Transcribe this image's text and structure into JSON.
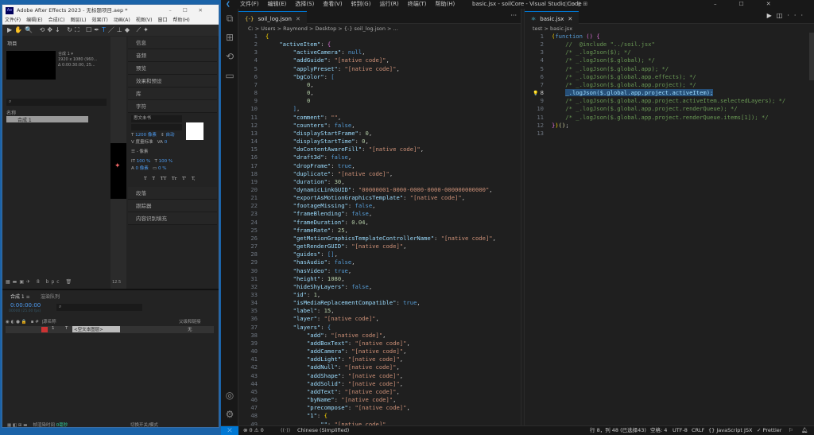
{
  "vscode": {
    "menu": [
      "文件(F)",
      "编辑(E)",
      "选择(S)",
      "查看(V)",
      "转到(G)",
      "运行(R)",
      "终端(T)",
      "帮助(H)"
    ],
    "window_title": "basic.jsx - soilCore - Visual Studio Code",
    "left": {
      "tab": "soil_log.json",
      "breadcrumb": "C: > Users > Raymond > Desktop > {-} soil_log.json > ...",
      "lines": [
        [
          [
            "y",
            "{"
          ]
        ],
        [
          [
            "p",
            "    "
          ],
          [
            "k",
            "\"activeItem\""
          ],
          [
            "p",
            ": "
          ],
          [
            "m",
            "{"
          ]
        ],
        [
          [
            "p",
            "        "
          ],
          [
            "k",
            "\"activeCamera\""
          ],
          [
            "p",
            ": "
          ],
          [
            "b",
            "null"
          ],
          [
            "p",
            ","
          ]
        ],
        [
          [
            "p",
            "        "
          ],
          [
            "k",
            "\"addGuide\""
          ],
          [
            "p",
            ": "
          ],
          [
            "s",
            "\"[native code]\""
          ],
          [
            "p",
            ","
          ]
        ],
        [
          [
            "p",
            "        "
          ],
          [
            "k",
            "\"applyPreset\""
          ],
          [
            "p",
            ": "
          ],
          [
            "s",
            "\"[native code]\""
          ],
          [
            "p",
            ","
          ]
        ],
        [
          [
            "p",
            "        "
          ],
          [
            "k",
            "\"bgColor\""
          ],
          [
            "p",
            ": "
          ],
          [
            "b",
            "["
          ]
        ],
        [
          [
            "p",
            "            "
          ],
          [
            "n",
            "0"
          ],
          [
            "p",
            ","
          ]
        ],
        [
          [
            "p",
            "            "
          ],
          [
            "n",
            "0"
          ],
          [
            "p",
            ","
          ]
        ],
        [
          [
            "p",
            "            "
          ],
          [
            "n",
            "0"
          ]
        ],
        [
          [
            "p",
            "        "
          ],
          [
            "b",
            "]"
          ],
          [
            "p",
            ","
          ]
        ],
        [
          [
            "p",
            "        "
          ],
          [
            "k",
            "\"comment\""
          ],
          [
            "p",
            ": "
          ],
          [
            "s",
            "\"\""
          ],
          [
            "p",
            ","
          ]
        ],
        [
          [
            "p",
            "        "
          ],
          [
            "k",
            "\"counters\""
          ],
          [
            "p",
            ": "
          ],
          [
            "b",
            "false"
          ],
          [
            "p",
            ","
          ]
        ],
        [
          [
            "p",
            "        "
          ],
          [
            "k",
            "\"displayStartFrame\""
          ],
          [
            "p",
            ": "
          ],
          [
            "n",
            "0"
          ],
          [
            "p",
            ","
          ]
        ],
        [
          [
            "p",
            "        "
          ],
          [
            "k",
            "\"displayStartTime\""
          ],
          [
            "p",
            ": "
          ],
          [
            "n",
            "0"
          ],
          [
            "p",
            ","
          ]
        ],
        [
          [
            "p",
            "        "
          ],
          [
            "k",
            "\"doContentAwareFill\""
          ],
          [
            "p",
            ": "
          ],
          [
            "s",
            "\"[native code]\""
          ],
          [
            "p",
            ","
          ]
        ],
        [
          [
            "p",
            "        "
          ],
          [
            "k",
            "\"draft3d\""
          ],
          [
            "p",
            ": "
          ],
          [
            "b",
            "false"
          ],
          [
            "p",
            ","
          ]
        ],
        [
          [
            "p",
            "        "
          ],
          [
            "k",
            "\"dropFrame\""
          ],
          [
            "p",
            ": "
          ],
          [
            "b",
            "true"
          ],
          [
            "p",
            ","
          ]
        ],
        [
          [
            "p",
            "        "
          ],
          [
            "k",
            "\"duplicate\""
          ],
          [
            "p",
            ": "
          ],
          [
            "s",
            "\"[native code]\""
          ],
          [
            "p",
            ","
          ]
        ],
        [
          [
            "p",
            "        "
          ],
          [
            "k",
            "\"duration\""
          ],
          [
            "p",
            ": "
          ],
          [
            "n",
            "30"
          ],
          [
            "p",
            ","
          ]
        ],
        [
          [
            "p",
            "        "
          ],
          [
            "k",
            "\"dynamicLinkGUID\""
          ],
          [
            "p",
            ": "
          ],
          [
            "s",
            "\"00000001-0000-0000-0000-000000000000\""
          ],
          [
            "p",
            ","
          ]
        ],
        [
          [
            "p",
            "        "
          ],
          [
            "k",
            "\"exportAsMotionGraphicsTemplate\""
          ],
          [
            "p",
            ": "
          ],
          [
            "s",
            "\"[native code]\""
          ],
          [
            "p",
            ","
          ]
        ],
        [
          [
            "p",
            "        "
          ],
          [
            "k",
            "\"footageMissing\""
          ],
          [
            "p",
            ": "
          ],
          [
            "b",
            "false"
          ],
          [
            "p",
            ","
          ]
        ],
        [
          [
            "p",
            "        "
          ],
          [
            "k",
            "\"frameBlending\""
          ],
          [
            "p",
            ": "
          ],
          [
            "b",
            "false"
          ],
          [
            "p",
            ","
          ]
        ],
        [
          [
            "p",
            "        "
          ],
          [
            "k",
            "\"frameDuration\""
          ],
          [
            "p",
            ": "
          ],
          [
            "n",
            "0.04"
          ],
          [
            "p",
            ","
          ]
        ],
        [
          [
            "p",
            "        "
          ],
          [
            "k",
            "\"frameRate\""
          ],
          [
            "p",
            ": "
          ],
          [
            "n",
            "25"
          ],
          [
            "p",
            ","
          ]
        ],
        [
          [
            "p",
            "        "
          ],
          [
            "k",
            "\"getMotionGraphicsTemplateControllerName\""
          ],
          [
            "p",
            ": "
          ],
          [
            "s",
            "\"[native code]\""
          ],
          [
            "p",
            ","
          ]
        ],
        [
          [
            "p",
            "        "
          ],
          [
            "k",
            "\"getRenderGUID\""
          ],
          [
            "p",
            ": "
          ],
          [
            "s",
            "\"[native code]\""
          ],
          [
            "p",
            ","
          ]
        ],
        [
          [
            "p",
            "        "
          ],
          [
            "k",
            "\"guides\""
          ],
          [
            "p",
            ": "
          ],
          [
            "b",
            "[]"
          ],
          [
            "p",
            ","
          ]
        ],
        [
          [
            "p",
            "        "
          ],
          [
            "k",
            "\"hasAudio\""
          ],
          [
            "p",
            ": "
          ],
          [
            "b",
            "false"
          ],
          [
            "p",
            ","
          ]
        ],
        [
          [
            "p",
            "        "
          ],
          [
            "k",
            "\"hasVideo\""
          ],
          [
            "p",
            ": "
          ],
          [
            "b",
            "true"
          ],
          [
            "p",
            ","
          ]
        ],
        [
          [
            "p",
            "        "
          ],
          [
            "k",
            "\"height\""
          ],
          [
            "p",
            ": "
          ],
          [
            "n",
            "1080"
          ],
          [
            "p",
            ","
          ]
        ],
        [
          [
            "p",
            "        "
          ],
          [
            "k",
            "\"hideShyLayers\""
          ],
          [
            "p",
            ": "
          ],
          [
            "b",
            "false"
          ],
          [
            "p",
            ","
          ]
        ],
        [
          [
            "p",
            "        "
          ],
          [
            "k",
            "\"id\""
          ],
          [
            "p",
            ": "
          ],
          [
            "n",
            "1"
          ],
          [
            "p",
            ","
          ]
        ],
        [
          [
            "p",
            "        "
          ],
          [
            "k",
            "\"isMediaReplacementCompatible\""
          ],
          [
            "p",
            ": "
          ],
          [
            "b",
            "true"
          ],
          [
            "p",
            ","
          ]
        ],
        [
          [
            "p",
            "        "
          ],
          [
            "k",
            "\"label\""
          ],
          [
            "p",
            ": "
          ],
          [
            "n",
            "15"
          ],
          [
            "p",
            ","
          ]
        ],
        [
          [
            "p",
            "        "
          ],
          [
            "k",
            "\"layer\""
          ],
          [
            "p",
            ": "
          ],
          [
            "s",
            "\"[native code]\""
          ],
          [
            "p",
            ","
          ]
        ],
        [
          [
            "p",
            "        "
          ],
          [
            "k",
            "\"layers\""
          ],
          [
            "p",
            ": "
          ],
          [
            "b",
            "{"
          ]
        ],
        [
          [
            "p",
            "            "
          ],
          [
            "k",
            "\"add\""
          ],
          [
            "p",
            ": "
          ],
          [
            "s",
            "\"[native code]\""
          ],
          [
            "p",
            ","
          ]
        ],
        [
          [
            "p",
            "            "
          ],
          [
            "k",
            "\"addBoxText\""
          ],
          [
            "p",
            ": "
          ],
          [
            "s",
            "\"[native code]\""
          ],
          [
            "p",
            ","
          ]
        ],
        [
          [
            "p",
            "            "
          ],
          [
            "k",
            "\"addCamera\""
          ],
          [
            "p",
            ": "
          ],
          [
            "s",
            "\"[native code]\""
          ],
          [
            "p",
            ","
          ]
        ],
        [
          [
            "p",
            "            "
          ],
          [
            "k",
            "\"addLight\""
          ],
          [
            "p",
            ": "
          ],
          [
            "s",
            "\"[native code]\""
          ],
          [
            "p",
            ","
          ]
        ],
        [
          [
            "p",
            "            "
          ],
          [
            "k",
            "\"addNull\""
          ],
          [
            "p",
            ": "
          ],
          [
            "s",
            "\"[native code]\""
          ],
          [
            "p",
            ","
          ]
        ],
        [
          [
            "p",
            "            "
          ],
          [
            "k",
            "\"addShape\""
          ],
          [
            "p",
            ": "
          ],
          [
            "s",
            "\"[native code]\""
          ],
          [
            "p",
            ","
          ]
        ],
        [
          [
            "p",
            "            "
          ],
          [
            "k",
            "\"addSolid\""
          ],
          [
            "p",
            ": "
          ],
          [
            "s",
            "\"[native code]\""
          ],
          [
            "p",
            ","
          ]
        ],
        [
          [
            "p",
            "            "
          ],
          [
            "k",
            "\"addText\""
          ],
          [
            "p",
            ": "
          ],
          [
            "s",
            "\"[native code]\""
          ],
          [
            "p",
            ","
          ]
        ],
        [
          [
            "p",
            "            "
          ],
          [
            "k",
            "\"byName\""
          ],
          [
            "p",
            ": "
          ],
          [
            "s",
            "\"[native code]\""
          ],
          [
            "p",
            ","
          ]
        ],
        [
          [
            "p",
            "            "
          ],
          [
            "k",
            "\"precompose\""
          ],
          [
            "p",
            ": "
          ],
          [
            "s",
            "\"[native code]\""
          ],
          [
            "p",
            ","
          ]
        ],
        [
          [
            "p",
            "            "
          ],
          [
            "k",
            "\"1\""
          ],
          [
            "p",
            ": "
          ],
          [
            "y",
            "{"
          ]
        ],
        [
          [
            "p",
            "                "
          ],
          [
            "k",
            "\"\""
          ],
          [
            "p",
            ": "
          ],
          [
            "s",
            "\"[native code]\""
          ]
        ]
      ]
    },
    "right": {
      "tab": "basic.jsx",
      "breadcrumb": "test > basic.jsx",
      "current_line": 8,
      "lines": [
        [
          [
            "y",
            "("
          ],
          [
            "b",
            "function"
          ],
          [
            "p",
            " "
          ],
          [
            "m",
            "()"
          ],
          [
            "p",
            " "
          ],
          [
            "m",
            "{"
          ]
        ],
        [
          [
            "c",
            "    //  @include \"../soil.jsx\""
          ]
        ],
        [
          [
            "c",
            "    /* _.logJson($); */"
          ]
        ],
        [
          [
            "c",
            "    /* _.logJson($.global); */"
          ]
        ],
        [
          [
            "c",
            "    /* _.logJson($.global.app); */"
          ]
        ],
        [
          [
            "c",
            "    /* _.logJson($.global.app.effects); */"
          ]
        ],
        [
          [
            "c",
            "    /* _.logJson($.global.app.project); */"
          ]
        ],
        [
          [
            "p",
            "    "
          ],
          [
            "sel",
            "_.logJson($.global.app.project.activeItem);"
          ]
        ],
        [
          [
            "c",
            "    /* _.logJson($.global.app.project.activeItem.selectedLayers); */"
          ]
        ],
        [
          [
            "c",
            "    /* _.logJson($.global.app.project.renderQueue); */"
          ]
        ],
        [
          [
            "c",
            "    /* _.logJson($.global.app.project.renderQueue.items[1]); */"
          ]
        ],
        [
          [
            "m",
            "}"
          ],
          [
            "y",
            ")"
          ],
          [
            "f",
            "()"
          ],
          [
            "p",
            ";"
          ]
        ],
        [
          [
            "p",
            ""
          ]
        ]
      ]
    },
    "status": {
      "errors": "0",
      "warnings": "0",
      "language_hint": "Chinese (Simplified)",
      "position": "行 8，列 48 (已选择43)",
      "spaces": "空格: 4",
      "encoding": "UTF-8",
      "eol": "CRLF",
      "language": "{} JavaScript JSX",
      "formatter": "✓ Prettier"
    }
  },
  "ae": {
    "title": "Adobe After Effects 2023 - 无标题项目.aep *",
    "menu": [
      "文件(F)",
      "编辑(E)",
      "合成(C)",
      "图层(L)",
      "效果(T)",
      "动画(A)",
      "视图(V)",
      "窗口",
      "帮助(H)"
    ],
    "project": {
      "title": "项目",
      "comp_name": "合成 1 ▾",
      "comp_res": "1920 x 1080 (960...",
      "comp_dur": "Δ 0:00:30:00, 25...",
      "col_name": "名称",
      "item": "合成 1",
      "bpc": "8 bpc"
    },
    "viewer_zoom": "12.5",
    "panels": [
      "信息",
      "音频",
      "预览",
      "效果和预设",
      "库",
      "字符"
    ],
    "character": {
      "font": "思文未书",
      "size": "1200 像素",
      "leading": "自动",
      "kerning": "度量标准",
      "tracking": "0",
      "stroke": "- 像素",
      "vscale": "100 %",
      "hscale": "100 %",
      "baseline": "0 像素",
      "tsume": "0 %",
      "styles": [
        "T",
        "T",
        "TT",
        "Tr",
        "T'",
        "T,"
      ]
    },
    "panels2": [
      "段落",
      "跟踪器",
      "内容识别填充"
    ],
    "timeline": {
      "tab": "合成 1",
      "tab2": "渲染队列",
      "timecode": "0:00:00:00",
      "fps": "00000 (25.00 fps)",
      "col_source": "源名称",
      "col_parent": "父级和链接",
      "layer_num": "1",
      "layer_name": "<空文本图层>",
      "parent": "无",
      "footer_render": "帧渲染时间",
      "footer_ms": "0毫秒",
      "footer_toggle": "切换开关/模式"
    }
  }
}
